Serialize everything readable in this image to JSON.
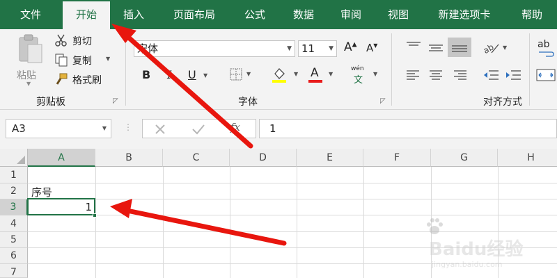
{
  "tabs": [
    {
      "label": "文件",
      "active": false
    },
    {
      "label": "开始",
      "active": true
    },
    {
      "label": "插入",
      "active": false
    },
    {
      "label": "页面布局",
      "active": false
    },
    {
      "label": "公式",
      "active": false
    },
    {
      "label": "数据",
      "active": false
    },
    {
      "label": "审阅",
      "active": false
    },
    {
      "label": "视图",
      "active": false
    },
    {
      "label": "新建选项卡",
      "active": false
    },
    {
      "label": "帮助",
      "active": false
    }
  ],
  "clipboard": {
    "paste_label": "粘贴",
    "cut_label": "剪切",
    "copy_label": "复制",
    "format_painter_label": "格式刷",
    "group_label": "剪贴板"
  },
  "font": {
    "name": "宋体",
    "size": "11",
    "bold": "B",
    "italic": "I",
    "underline": "U",
    "font_color_glyph": "A",
    "phonetic_top": "wén",
    "phonetic_bottom": "文",
    "group_label": "字体"
  },
  "alignment": {
    "group_label": "对齐方式",
    "wrap_label": "ab"
  },
  "formula_bar": {
    "name_box": "A3",
    "fx": "fx",
    "content": "1"
  },
  "grid": {
    "columns": [
      "A",
      "B",
      "C",
      "D",
      "E",
      "F",
      "G",
      "H"
    ],
    "rows": [
      "1",
      "2",
      "3",
      "4",
      "5",
      "6",
      "7"
    ],
    "cells": {
      "A2": "序号",
      "A3": "1"
    },
    "selected_cell": "A3"
  },
  "watermark": {
    "brand": "Baidu经验",
    "url": "jingyan.baidu.com"
  },
  "colors": {
    "accent": "#217346",
    "ribbon_bg": "#f3f3f3",
    "arrow": "#e8160e"
  }
}
